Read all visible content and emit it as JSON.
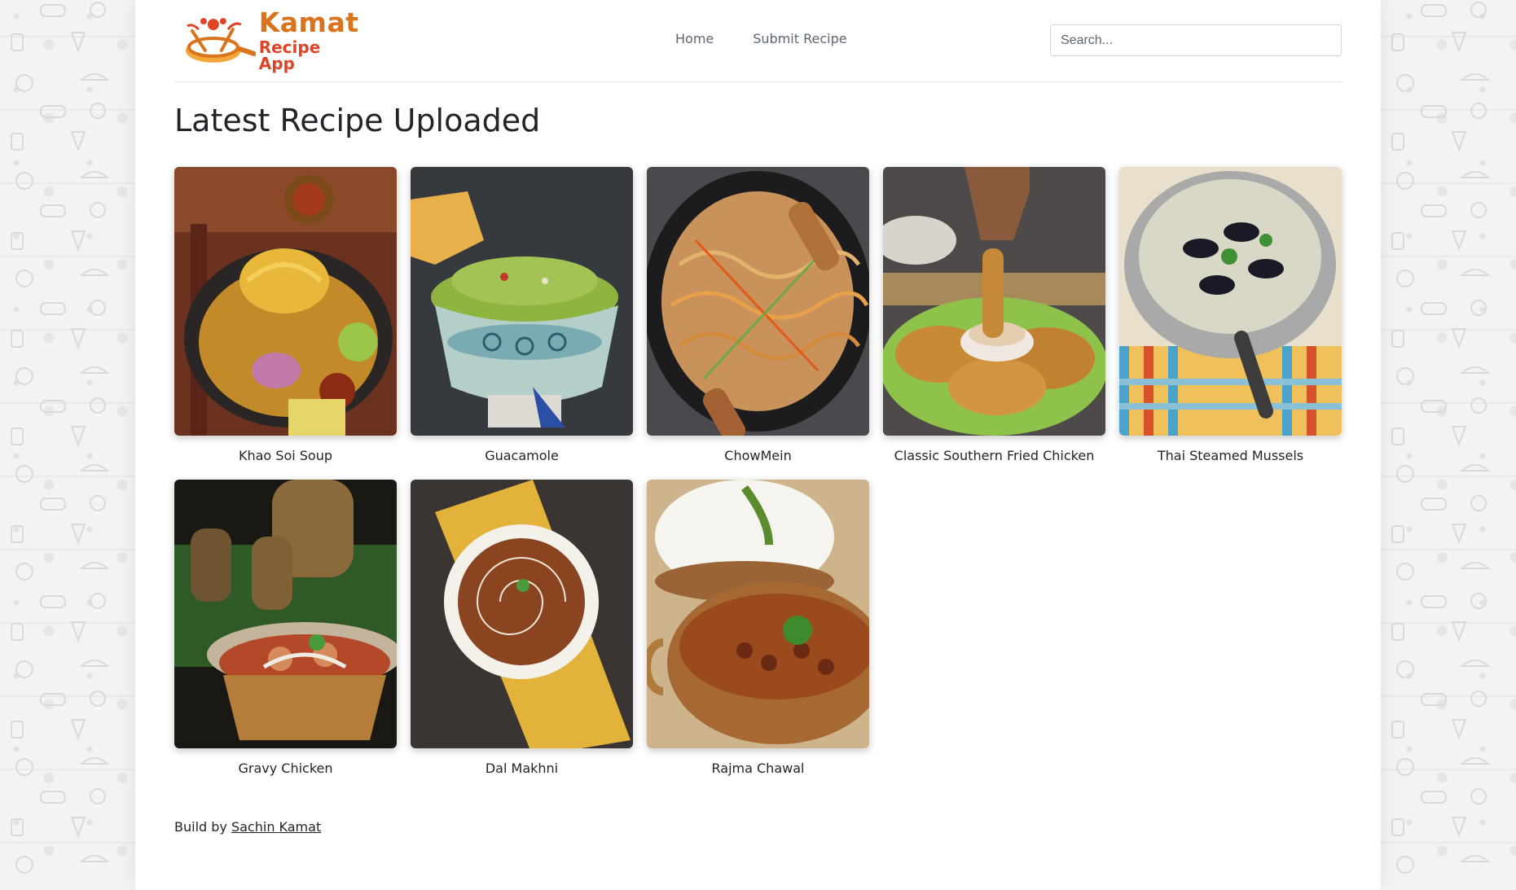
{
  "app": {
    "logo_title": "Kamat",
    "logo_subtitle": "Recipe App"
  },
  "nav": {
    "items": [
      {
        "label": "Home"
      },
      {
        "label": "Submit Recipe"
      }
    ]
  },
  "search": {
    "placeholder": "Search..."
  },
  "main": {
    "heading": "Latest Recipe Uploaded",
    "recipes": [
      {
        "name": "Khao Soi Soup",
        "image": "khao-soi-soup-photo"
      },
      {
        "name": "Guacamole",
        "image": "guacamole-photo"
      },
      {
        "name": "ChowMein",
        "image": "chowmein-photo"
      },
      {
        "name": "Classic Southern Fried Chicken",
        "image": "fried-chicken-photo"
      },
      {
        "name": "Thai Steamed Mussels",
        "image": "mussels-photo"
      },
      {
        "name": "Gravy Chicken",
        "image": "gravy-chicken-photo"
      },
      {
        "name": "Dal Makhni",
        "image": "dal-makhni-photo"
      },
      {
        "name": "Rajma Chawal",
        "image": "rajma-chawal-photo"
      }
    ]
  },
  "footer": {
    "prefix": "Build by",
    "author_link": "Sachin Kamat"
  },
  "colors": {
    "logo_orange": "#d9731c",
    "logo_red": "#e04427",
    "background_pattern": "#f3f3f3"
  }
}
